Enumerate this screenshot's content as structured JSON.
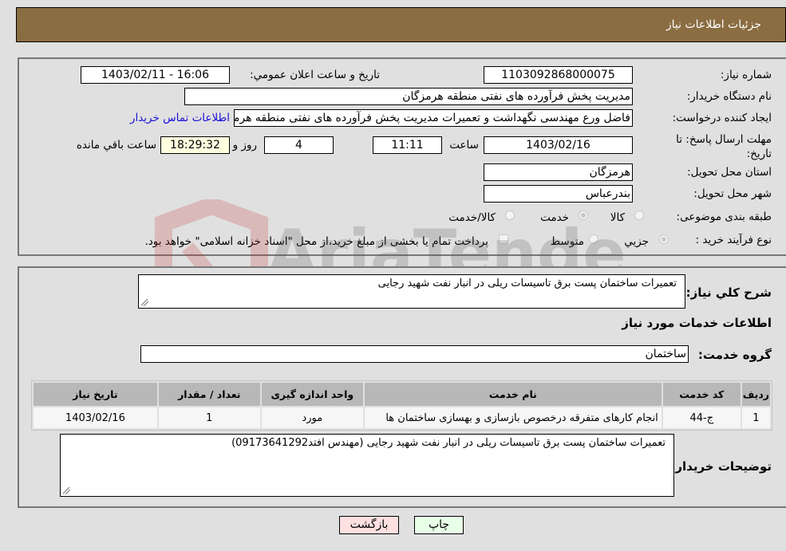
{
  "header": {
    "title": "جزئیات اطلاعات نیاز"
  },
  "form": {
    "need_number": {
      "label": "شماره نیاز:",
      "value": "1103092868000075"
    },
    "announce_datetime": {
      "label": "تاریخ و ساعت اعلان عمومي:",
      "value": "1403/02/11 - 16:06"
    },
    "buyer_org": {
      "label": "نام دستگاه خریدار:",
      "value": "مدیریت پخش فرآورده های نفتی منطقه هرمزگان"
    },
    "requester": {
      "label": "ایجاد کننده درخواست:",
      "value": "فاضل ورع مهندسی نگهداشت و تعمیرات مدیریت پخش فرآورده های نفتی منطقه هرمزگان",
      "contact_link": "اطلاعات تماس خریدار"
    },
    "deadline": {
      "label": "مهلت ارسال پاسخ: تا تاریخ:",
      "date": "1403/02/16",
      "time_label": "ساعت",
      "time": "11:11",
      "days": "4",
      "days_label": "روز و",
      "remaining": "18:29:32",
      "remaining_label": "ساعت باقي مانده"
    },
    "province": {
      "label": "استان محل تحویل:",
      "value": "هرمزگان"
    },
    "city": {
      "label": "شهر محل تحویل:",
      "value": "بندرعباس"
    },
    "category": {
      "label": "طبقه بندی موضوعی:",
      "options": [
        {
          "label": "کالا",
          "checked": false
        },
        {
          "label": "خدمت",
          "checked": true
        },
        {
          "label": "کالا/خدمت",
          "checked": false
        }
      ]
    },
    "purchase_type": {
      "label": "نوع فرآیند خرید :",
      "options": [
        {
          "label": "جزیي",
          "checked": true
        },
        {
          "label": "متوسط",
          "checked": false
        }
      ],
      "treasury_checkbox_label": "پرداخت تمام یا بخشی از مبلغ خرید،از محل \"اسناد خزانه اسلامی\" خواهد بود.",
      "treasury_checked": false
    }
  },
  "details": {
    "general_desc_label": "شرح کلي نیاز:",
    "general_desc": "تعمیرات ساختمان پست برق تاسیسات ریلی در انبار نفت شهید رجایی",
    "services_heading": "اطلاعات خدمات مورد نیاز",
    "service_group_label": "گروه خدمت:",
    "service_group": "ساختمان",
    "table": {
      "headers": [
        "ردیف",
        "کد خدمت",
        "نام خدمت",
        "واحد اندازه گیری",
        "تعداد / مقدار",
        "تاریخ نیاز"
      ],
      "rows": [
        [
          "1",
          "ج-44",
          "انجام کارهای متفرقه درخصوص بازسازی و بهسازی ساختمان ها",
          "مورد",
          "1",
          "1403/02/16"
        ]
      ]
    },
    "buyer_notes_label": "توضیحات خریدار:",
    "buyer_notes": "تعمیرات ساختمان پست برق تاسیسات ریلی در انبار نفت شهید رجایی (مهندس افتد09173641292)"
  },
  "buttons": {
    "print": "چاپ",
    "back": "بازگشت"
  },
  "watermark": {
    "text": "AriaTender.neT"
  }
}
